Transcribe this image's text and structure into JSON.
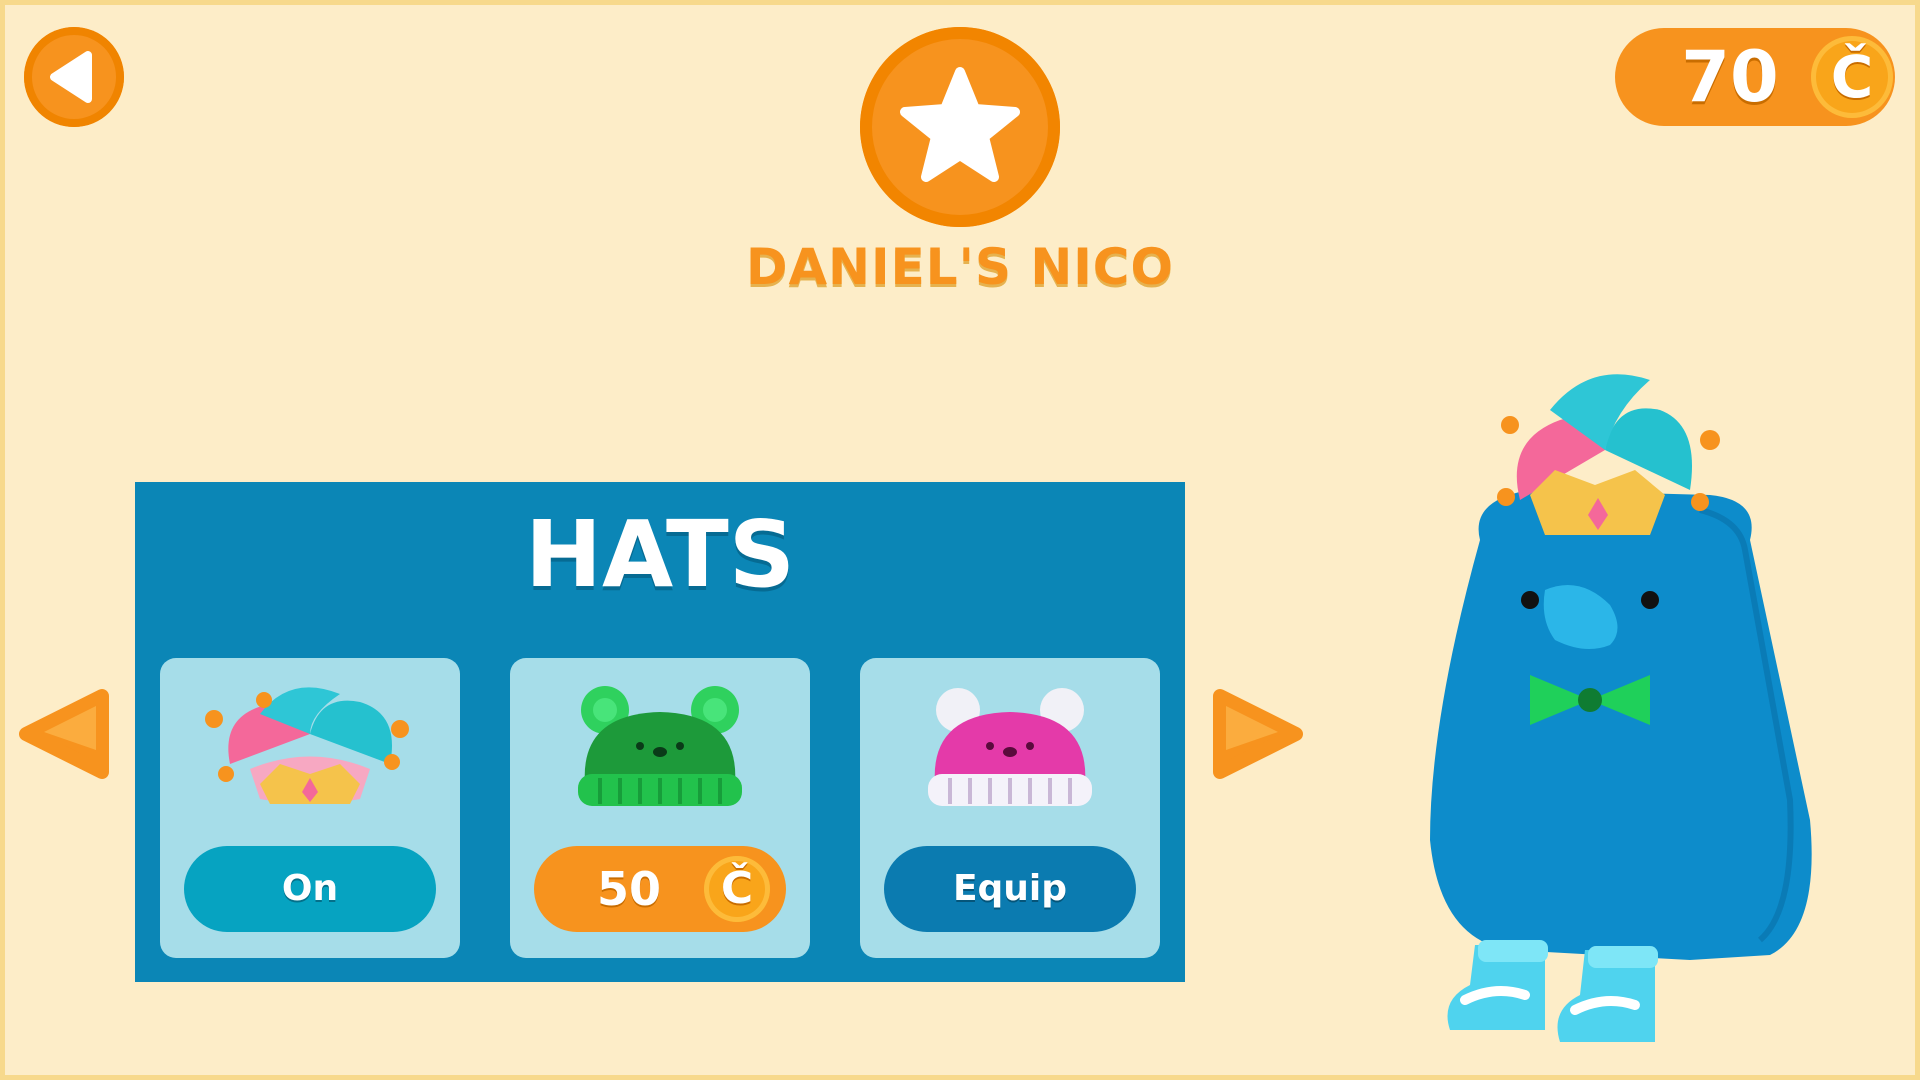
{
  "header": {
    "title": "DANIEL'S NICO",
    "coins": "70",
    "currency_symbol": "Č"
  },
  "shop": {
    "category": "HATS",
    "items": [
      {
        "name": "Jester Hat",
        "button_label": "On",
        "state": "equipped"
      },
      {
        "name": "Green Bear Beanie",
        "price": "50",
        "currency_symbol": "Č",
        "state": "buy"
      },
      {
        "name": "Pink Bear Beanie",
        "button_label": "Equip",
        "state": "owned"
      }
    ]
  },
  "icons": {
    "back": "back-arrow-icon",
    "badge": "star-icon",
    "prev": "left-arrow-icon",
    "next": "right-arrow-icon"
  },
  "colors": {
    "background": "#fdedc8",
    "accent": "#f7931e",
    "panel": "#0b86b6",
    "card": "#a6dde9"
  }
}
